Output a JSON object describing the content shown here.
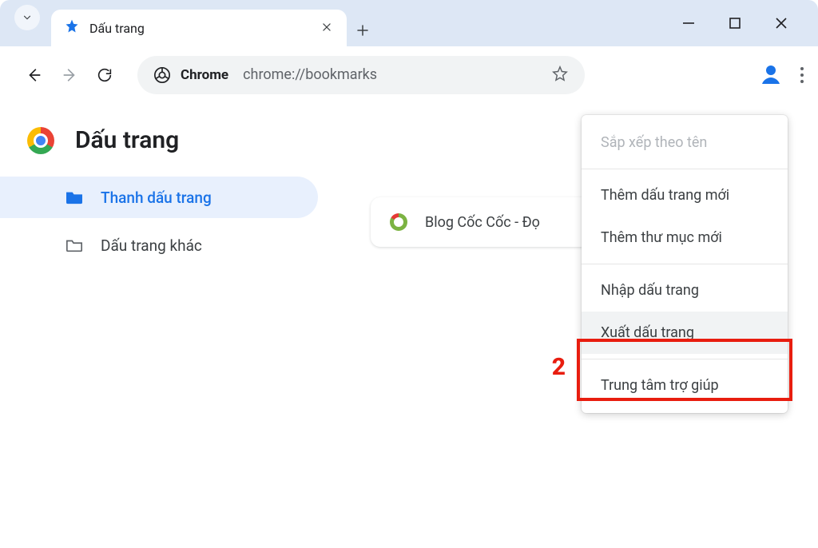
{
  "window": {
    "tab_title": "Dấu trang",
    "url": "chrome://bookmarks",
    "omnibox_label": "Chrome"
  },
  "page": {
    "title": "Dấu trang"
  },
  "sidebar": {
    "items": [
      {
        "label": "Thanh dấu trang"
      },
      {
        "label": "Dấu trang khác"
      }
    ]
  },
  "bookmarks": [
    {
      "title": "Blog Cốc Cốc - Đọ"
    }
  ],
  "menu": {
    "sort": "Sắp xếp theo tên",
    "add_bm": "Thêm dấu trang mới",
    "add_folder": "Thêm thư mục mới",
    "import": "Nhập dấu trang",
    "export": "Xuất dấu trang",
    "help": "Trung tâm trợ giúp"
  },
  "annot": {
    "num2": "2"
  }
}
